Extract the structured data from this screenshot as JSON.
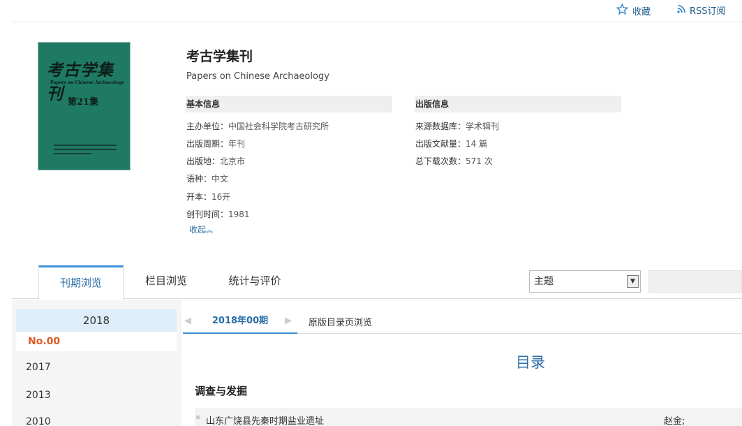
{
  "topbar": {
    "favorite_label": "收藏",
    "rss_label": "RSS订阅"
  },
  "cover": {
    "title": "考古学集刊",
    "subtitle": "Papers on Chinese Archaeology",
    "volume": "第21集"
  },
  "journal": {
    "title": "考古学集刊",
    "en_title": "Papers on Chinese Archaeology"
  },
  "basic_info": {
    "heading": "基本信息",
    "items": [
      {
        "label": "主办单位：",
        "value": "中国社会科学院考古研究所"
      },
      {
        "label": "出版周期：",
        "value": "年刊"
      },
      {
        "label": "出版地：",
        "value": "北京市"
      },
      {
        "label": "语种：",
        "value": "中文"
      },
      {
        "label": "开本：",
        "value": "16开"
      },
      {
        "label": "创刊时间：",
        "value": "1981"
      }
    ],
    "collapse_label": "收起"
  },
  "publish_info": {
    "heading": "出版信息",
    "items": [
      {
        "label": "来源数据库：",
        "value": "学术辑刊"
      },
      {
        "label": "出版文献量：",
        "value": "14 篇"
      },
      {
        "label": "总下载次数：",
        "value": "571 次"
      }
    ]
  },
  "tabs": [
    "刊期浏览",
    "栏目浏览",
    "统计与评价"
  ],
  "search": {
    "selected_option": "主题"
  },
  "years": {
    "active_year": "2018",
    "active_issue": "No.00",
    "others": [
      "2017",
      "2013",
      "2010"
    ]
  },
  "issue_bar": {
    "current_issue": "2018年00期",
    "original_toc": "原版目录页浏览"
  },
  "toc": {
    "title": "目录",
    "section": "调查与发掘",
    "articles": [
      {
        "title": "山东广饶县先秦时期盐业遗址",
        "author": "赵金;"
      }
    ]
  },
  "colors": {
    "accent": "#2a6ea6",
    "issue_active": "#e05a24",
    "tab_border": "#3e8fd8"
  }
}
